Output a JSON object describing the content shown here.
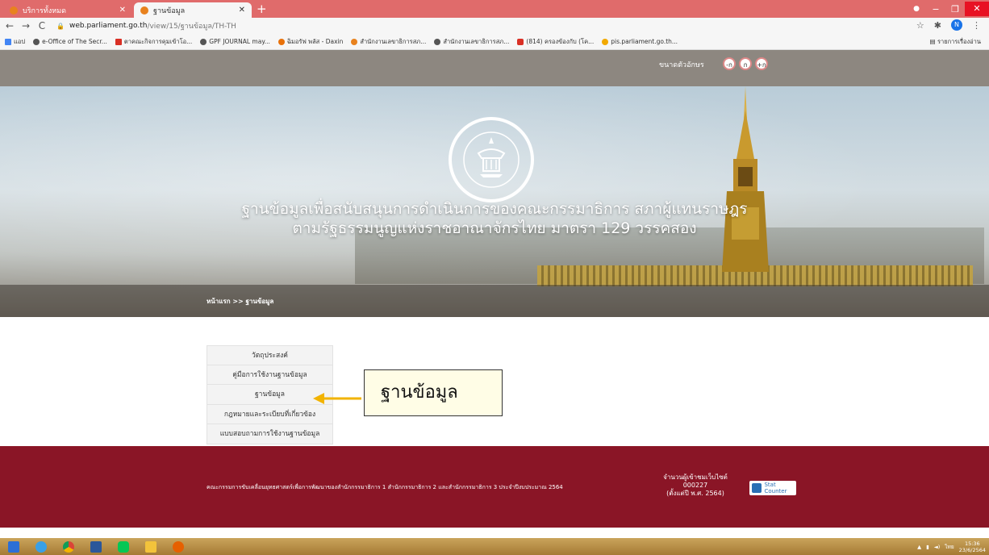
{
  "browser": {
    "tabs": [
      {
        "title": "บริการทั้งหมด"
      },
      {
        "title": "ฐานข้อมูล"
      }
    ],
    "new_tab": "+",
    "window_controls": {
      "minimize": "−",
      "maximize": "❐",
      "close": "✕"
    },
    "nav": {
      "back": "←",
      "forward": "→",
      "reload": "C"
    },
    "url": {
      "domain": "web.parliament.go.th",
      "path": "/view/15/ฐานข้อมูล/TH-TH"
    },
    "profile_initial": "N",
    "bookmarks": [
      {
        "label": "แอป",
        "color": "#4285f4"
      },
      {
        "label": "e-Office of The Secr...",
        "color": "#555555"
      },
      {
        "label": "ตาคณะกิจการคุมเข้าโอ...",
        "color": "#d93025"
      },
      {
        "label": "GPF JOURNAL may...",
        "color": "#555555"
      },
      {
        "label": "ฉิมอรัฟ พลัส - Daxin",
        "color": "#e8710a"
      },
      {
        "label": "สำนักงานเลขาธิการสภ...",
        "color": "#e8821e"
      },
      {
        "label": "สำนักงานเลขาธิการสภ...",
        "color": "#555555"
      },
      {
        "label": "(814) ครองข้องกับ (โค...",
        "color": "#d93025"
      },
      {
        "label": "pis.parliament.go.th...",
        "color": "#f2a900"
      }
    ],
    "reading_list": "รายการเรื่องอ่าน"
  },
  "page": {
    "font_size_label": "ขนาดตัวอักษร",
    "font_buttons": [
      "-ก",
      "ก",
      "+ก"
    ],
    "hero_title_line1": "ฐานข้อมูลเพื่อสนับสนุนการดำเนินการของคณะกรรมาธิการ สภาผู้แทนราษฎร",
    "hero_title_line2": "ตามรัฐธรรมนูญแห่งราชอาณาจักรไทย มาตรา 129 วรรคสอง",
    "breadcrumb": "หน้าแรก >> ฐานข้อมูล",
    "menu": [
      "วัตถุประสงค์",
      "คู่มือการใช้งานฐานข้อมูล",
      "ฐานข้อมูล",
      "กฎหมายและระเบียบที่เกี่ยวข้อง",
      "แบบสอบถามการใช้งานฐานข้อมูล"
    ],
    "callout": "ฐานข้อมูล",
    "footer": {
      "text": "คณะกรรมการขับเคลื่อนยุทธศาสตร์เพื่อการพัฒนาของสำนักกรรมาธิการ 1 สำนักกรรมาธิการ 2 และสำนักกรรมาธิการ 3 ประจำปีงบประมาณ 2564",
      "visitors_label": "จำนวนผู้เข้าชมเว็บไซต์",
      "visitors_count": "000227",
      "visitors_since": "(ตั้งแต่ปี พ.ศ. 2564)",
      "stat_badge": "Stat Counter"
    }
  },
  "taskbar": {
    "tray_lang": "ไทย",
    "time": "15:36",
    "date": "23/6/2564"
  }
}
